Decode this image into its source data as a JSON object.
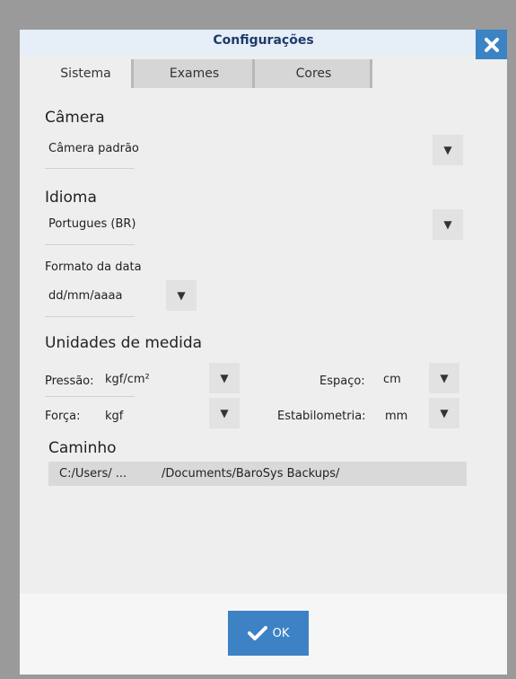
{
  "dialog": {
    "title": "Configurações",
    "close_icon": "close-icon",
    "tabs": [
      {
        "label": "Sistema",
        "active": true
      },
      {
        "label": "Exames",
        "active": false
      },
      {
        "label": "Cores",
        "active": false
      }
    ]
  },
  "camera": {
    "label": "Câmera",
    "value": "Câmera padrão"
  },
  "language": {
    "label": "Idioma",
    "value": "Portugues (BR)"
  },
  "date_format": {
    "label": "Formato da data",
    "value": "dd/mm/aaaa"
  },
  "units": {
    "label": "Unidades de medida",
    "pressure": {
      "label": "Pressão:",
      "value": "kgf/cm²"
    },
    "space": {
      "label": "Espaço:",
      "value": "cm"
    },
    "force": {
      "label": "Força:",
      "value": "kgf"
    },
    "stabilometry": {
      "label": "Estabilometria:",
      "value": "mm"
    }
  },
  "path": {
    "label": "Caminho",
    "value_start": "C:/Users/ ...",
    "value_end": "/Documents/BaroSys Backups/"
  },
  "footer": {
    "ok_label": "OK",
    "ok_icon": "checkmark-icon"
  },
  "colors": {
    "accent": "#3d82c5",
    "title": "#1f3b6b"
  }
}
